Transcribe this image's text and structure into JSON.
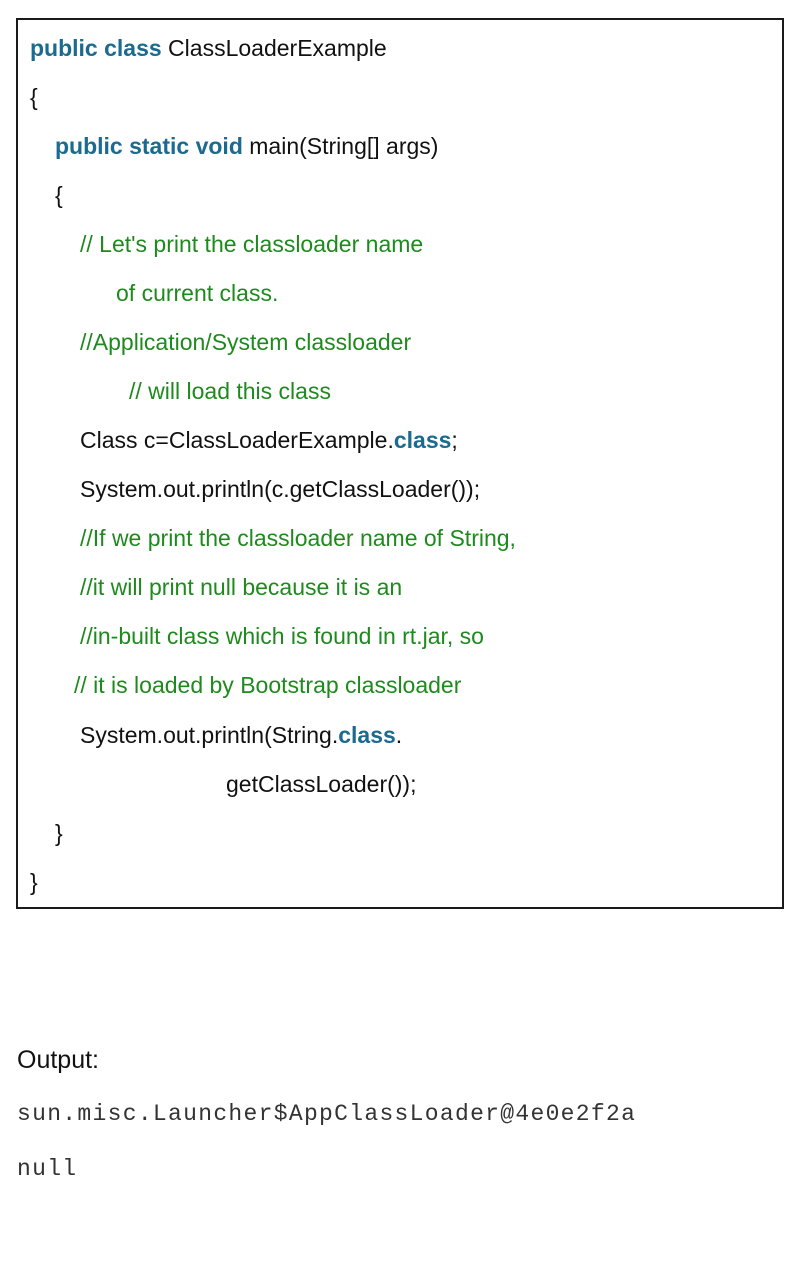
{
  "code": {
    "l1_kw": "public class",
    "l1_tx": " ClassLoaderExample",
    "l2": "{",
    "l3_kw": "public static void",
    "l3_tx": " main(String[] args)",
    "l4": "{",
    "l5": "// Let's print the classloader name",
    "l6": "of current class.",
    "l7": "//Application/System classloader",
    "l8": "// will load this class",
    "l9_tx": "Class c=ClassLoaderExample.",
    "l9_kw": "class",
    "l9_end": ";",
    "l10": "System.out.println(c.getClassLoader());",
    "l11": "//If we print the classloader name of String,",
    "l12": "//it will print null because it is an",
    "l13": "//in-built class which is found in rt.jar, so",
    "l14": "// it is loaded by Bootstrap classloader",
    "l15_tx": "System.out.println(String.",
    "l15_kw": "class",
    "l15_end": ".",
    "l16": "getClassLoader());",
    "l17": "}",
    "l18": "}"
  },
  "output": {
    "label": "Output:",
    "lines": [
      "sun.misc.Launcher$AppClassLoader@4e0e2f2a",
      "null"
    ]
  },
  "colors": {
    "keyword": "#1b6a8f",
    "comment": "#1e8a1e",
    "text": "#111111"
  }
}
